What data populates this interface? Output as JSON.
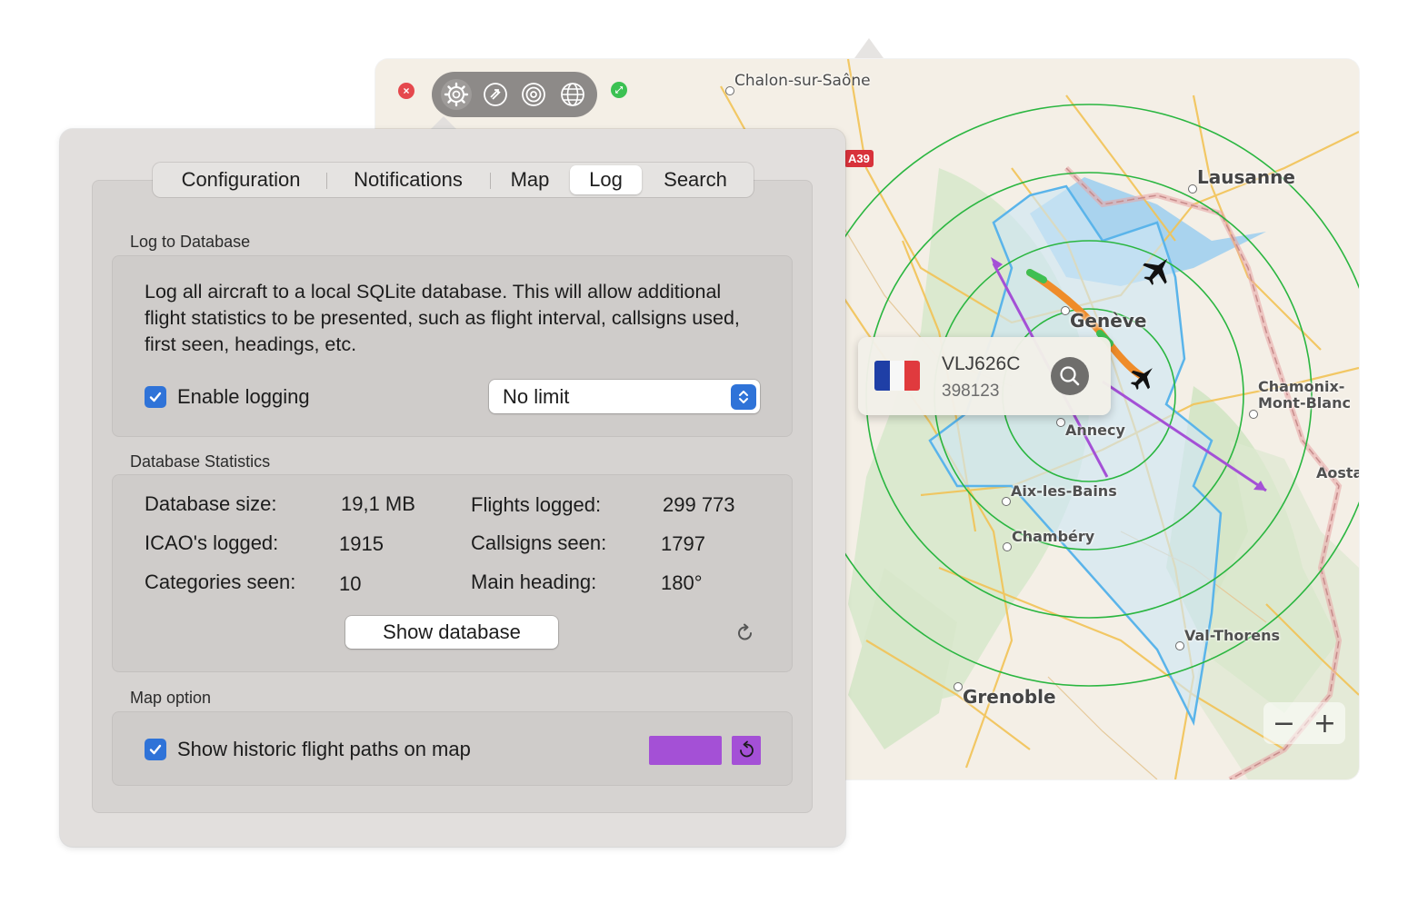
{
  "map": {
    "cities": {
      "chalon": "Chalon-sur-Saône",
      "lausanne": "Lausanne",
      "geneve": "Genève",
      "annecy": "Annecy",
      "aix": "Aix-les-Bains",
      "chambery": "Chambéry",
      "grenoble": "Grenoble",
      "chamonix_line1": "Chamonix-",
      "chamonix_line2": "Mont-Blanc",
      "aosta": "Aosta",
      "valthorens": "Val-Thorens"
    },
    "road_shield": "A39",
    "zoom_out_label": "−",
    "zoom_in_label": "+",
    "toolbar_icons": [
      "gear-icon",
      "rotate-arrows-icon",
      "radar-icon",
      "globe-icon"
    ],
    "colors": {
      "range_rings": "#2ab640",
      "coverage_fill": "#cfe7f4",
      "coverage_stroke": "#5ab4ea",
      "historic_path": "#a450d6",
      "current_track": "#ef8c2a"
    }
  },
  "popup": {
    "callsign": "VLJ626C",
    "icao": "398123",
    "flag": "France"
  },
  "prefs": {
    "tabs": [
      {
        "label": "Configuration",
        "active": false
      },
      {
        "label": "Notifications",
        "active": false
      },
      {
        "label": "Map",
        "active": false
      },
      {
        "label": "Log",
        "active": true
      },
      {
        "label": "Search",
        "active": false
      }
    ],
    "log_section": {
      "title": "Log to Database",
      "description": "Log all aircraft to a local SQLite database. This will allow additional flight statistics to be presented, such as flight interval, callsigns used, first seen, headings, etc.",
      "enable_label": "Enable logging",
      "enable_checked": true,
      "limit_value": "No limit"
    },
    "stats_section": {
      "title": "Database Statistics",
      "db_size_label": "Database size:",
      "db_size_value": "19,1 MB",
      "flights_label": "Flights logged:",
      "flights_value": "299 773",
      "icao_label": "ICAO's logged:",
      "icao_value": "1915",
      "callsigns_label": "Callsigns seen:",
      "callsigns_value": "1797",
      "categories_label": "Categories seen:",
      "categories_value": "10",
      "heading_label": "Main heading:",
      "heading_value": "180°",
      "show_db_button": "Show database"
    },
    "map_section": {
      "title": "Map option",
      "historic_label": "Show historic flight paths on map",
      "historic_checked": true,
      "path_color": "#a450d6"
    },
    "accent_color": "#2f73d8"
  }
}
